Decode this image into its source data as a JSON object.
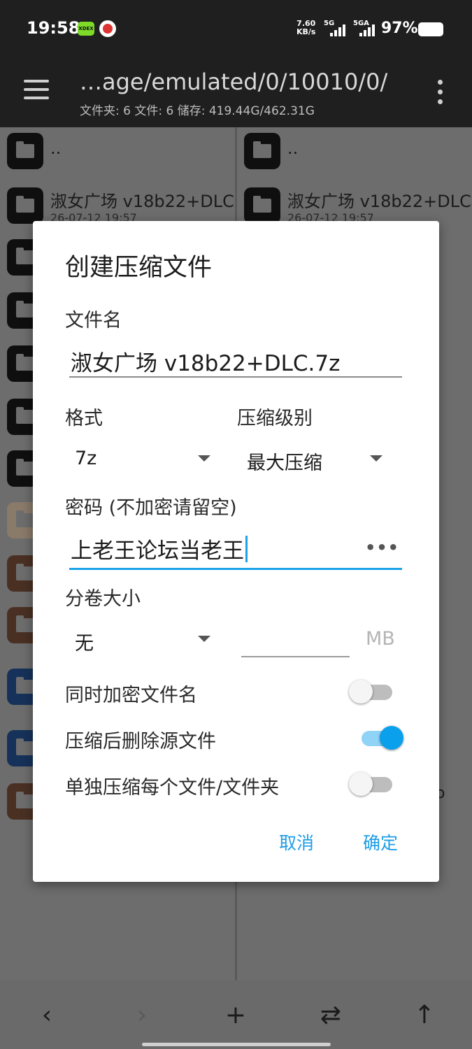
{
  "status_bar": {
    "time": "19:58",
    "app_icon_1": "XDEX",
    "net_speed_value": "7.60",
    "net_speed_unit": "KB/s",
    "sim1": "5G",
    "sim2": "5GA",
    "battery": "97%"
  },
  "toolbar": {
    "path": "…age/emulated/0/10010/0/",
    "info": "文件夹: 6  文件: 6  储存: 419.44G/462.31G"
  },
  "left_pane": {
    "parent": "..",
    "first_item_name": "淑女广场 v18b22+DLC",
    "first_item_date": "26-07-12 19:57"
  },
  "right_pane": {
    "parent": "..",
    "first_item_name": "淑女广场 v18b22+DLC",
    "first_item_date": "26-07-12 19:57",
    "partial_text": "o"
  },
  "dialog": {
    "title": "创建压缩文件",
    "filename_label": "文件名",
    "filename_value": "淑女广场 v18b22+DLC.7z",
    "format_label": "格式",
    "format_value": "7z",
    "level_label": "压缩级别",
    "level_value": "最大压缩",
    "password_label": "密码 (不加密请留空)",
    "password_value": "上老王论坛当老王",
    "password_toggle_icon": "•••",
    "split_label": "分卷大小",
    "split_value": "无",
    "split_unit": "MB",
    "encrypt_names_label": "同时加密文件名",
    "encrypt_names_on": false,
    "delete_source_label": "压缩后删除源文件",
    "delete_source_on": true,
    "separate_label": "单独压缩每个文件/文件夹",
    "separate_on": false,
    "cancel": "取消",
    "ok": "确定"
  },
  "bottom_bar": {
    "back": "‹",
    "forward": "›",
    "add": "+",
    "swap": "⇄",
    "up": "↑"
  },
  "colors": {
    "accent": "#1aa3e8",
    "toolbar_bg": "#1f1f1f",
    "dialog_bg": "#ffffff"
  }
}
